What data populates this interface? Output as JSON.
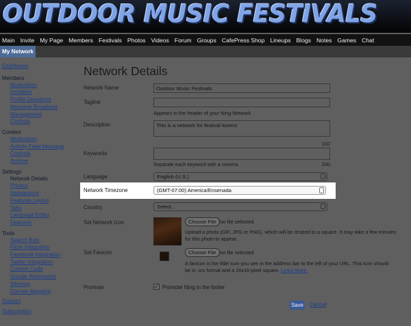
{
  "banner": {
    "logo_text": "OUTDOOR MUSIC FESTIVALS"
  },
  "nav": {
    "items": [
      "Main",
      "Invite",
      "My Page",
      "Members",
      "Festivals",
      "Photos",
      "Videos",
      "Forum",
      "Groups",
      "CafePress Shop",
      "Lineups",
      "Blogs",
      "Notes",
      "Games",
      "Chat"
    ]
  },
  "subnav": {
    "active_tab": "My Network"
  },
  "sidebar": {
    "dashboard": "Dashboard",
    "members_head": "Members",
    "members": [
      "Moderation",
      "Invitation",
      "Profile Questions",
      "Message Broadcast",
      "Management",
      "Controls"
    ],
    "content_head": "Content",
    "content": [
      "Moderation",
      "Activity Feed Message",
      "Controls",
      "Archive"
    ],
    "settings_head": "Settings",
    "settings_current": "Network Details",
    "settings": [
      "Privacy",
      "Appearance",
      "Features Layout",
      "Tabs",
      "Language Editor",
      "Features"
    ],
    "tools_head": "Tools",
    "tools": [
      "Search Bots",
      "Flickr Integration",
      "Facebook Integration",
      "Twitter Integration",
      "Custom Code",
      "Google Webmaster",
      "Sitemap",
      "Domain Mapping"
    ],
    "support": "Support",
    "subscription": "Subscription"
  },
  "form": {
    "title": "Network Details",
    "name_label": "Network Name",
    "name_value": "Outdoor Music Festivals",
    "tagline_label": "Tagline",
    "tagline_value": "",
    "tagline_hint": "Appears in the header of your Ning Network",
    "description_label": "Description",
    "description_value": "This is a network for festival-lovers!",
    "description_count": "102",
    "keywords_label": "Keywords",
    "keywords_value": "",
    "keywords_hint": "Separate each keyword with a comma",
    "keywords_count": "200",
    "language_label": "Language",
    "language_value": "English (U.S.)",
    "timezone_label": "Network Timezone",
    "timezone_value": "(GMT-07:00) America/Ensenada",
    "country_label": "Country",
    "country_value": "Select...",
    "icon_label": "Set Network Icon",
    "choose_file": "Choose File",
    "no_file": "no file selected",
    "icon_hint_1": "Upload a photo (GIF, JPG or PNG), which will be resized to a square. It may take a few minutes",
    "icon_hint_2": "for this photo to appear.",
    "favicon_label": "Set Favicon",
    "favicon_hint_1": "A favicon is the little icon you see in the address bar to the left of your URL. This icon should",
    "favicon_hint_2": "be in .ico format and a 16x16-pixel square.",
    "learn_more": "Learn More.",
    "promote_label": "Promote",
    "promote_checkbox": "Promote Ning in the footer",
    "promote_checked": true,
    "save": "Save",
    "cancel": "Cancel"
  }
}
